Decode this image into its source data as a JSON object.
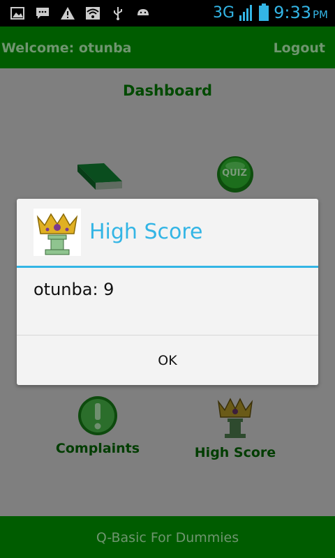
{
  "status_bar": {
    "network": "3G",
    "time": "9:33",
    "ampm": "PM",
    "icons_left": [
      "image-icon",
      "messenger-icon",
      "warning-icon",
      "wifi-icon",
      "usb-icon",
      "android-icon"
    ],
    "icons_right": [
      "signal-icon",
      "battery-icon"
    ],
    "accent_color": "#33b5e5"
  },
  "header": {
    "welcome": "Welcome: otunba",
    "logout_label": "Logout",
    "bar_color": "#005c00"
  },
  "dashboard": {
    "title": "Dashboard",
    "tiles": [
      {
        "icon": "book-icon"
      },
      {
        "icon": "quiz-icon",
        "badge": "QUIZ"
      },
      {
        "icon": "complaints-icon",
        "label": "Complaints"
      },
      {
        "icon": "crown-trophy-icon",
        "label": "High Score"
      }
    ]
  },
  "dialog": {
    "title": "High Score",
    "message": "otunba: 9",
    "ok_label": "OK",
    "accent_color": "#33b5e5"
  },
  "footer": {
    "title": "Q-Basic For Dummies"
  }
}
